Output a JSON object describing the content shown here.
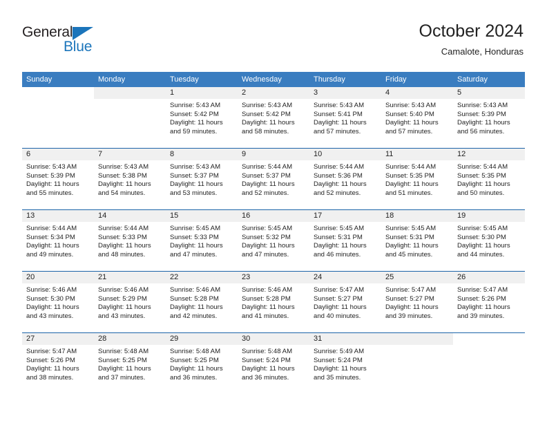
{
  "brand": {
    "name_top": "General",
    "name_bottom": "Blue",
    "accent_color": "#1b75bb"
  },
  "header": {
    "title": "October 2024",
    "subtitle": "Camalote, Honduras"
  },
  "colors": {
    "header_row": "#3a7dc0",
    "row_divider": "#1b63a8",
    "day_number_band": "#f0f0f0",
    "text": "#222222"
  },
  "weekday_headers": [
    "Sunday",
    "Monday",
    "Tuesday",
    "Wednesday",
    "Thursday",
    "Friday",
    "Saturday"
  ],
  "weeks": [
    [
      {
        "day": "",
        "sunrise": "",
        "sunset": "",
        "daylight": "",
        "empty": true,
        "shaded": false
      },
      {
        "day": "",
        "sunrise": "",
        "sunset": "",
        "daylight": "",
        "empty": true,
        "shaded": true
      },
      {
        "day": "1",
        "sunrise": "Sunrise: 5:43 AM",
        "sunset": "Sunset: 5:42 PM",
        "daylight": "Daylight: 11 hours and 59 minutes."
      },
      {
        "day": "2",
        "sunrise": "Sunrise: 5:43 AM",
        "sunset": "Sunset: 5:42 PM",
        "daylight": "Daylight: 11 hours and 58 minutes."
      },
      {
        "day": "3",
        "sunrise": "Sunrise: 5:43 AM",
        "sunset": "Sunset: 5:41 PM",
        "daylight": "Daylight: 11 hours and 57 minutes."
      },
      {
        "day": "4",
        "sunrise": "Sunrise: 5:43 AM",
        "sunset": "Sunset: 5:40 PM",
        "daylight": "Daylight: 11 hours and 57 minutes."
      },
      {
        "day": "5",
        "sunrise": "Sunrise: 5:43 AM",
        "sunset": "Sunset: 5:39 PM",
        "daylight": "Daylight: 11 hours and 56 minutes."
      }
    ],
    [
      {
        "day": "6",
        "sunrise": "Sunrise: 5:43 AM",
        "sunset": "Sunset: 5:39 PM",
        "daylight": "Daylight: 11 hours and 55 minutes."
      },
      {
        "day": "7",
        "sunrise": "Sunrise: 5:43 AM",
        "sunset": "Sunset: 5:38 PM",
        "daylight": "Daylight: 11 hours and 54 minutes."
      },
      {
        "day": "8",
        "sunrise": "Sunrise: 5:43 AM",
        "sunset": "Sunset: 5:37 PM",
        "daylight": "Daylight: 11 hours and 53 minutes."
      },
      {
        "day": "9",
        "sunrise": "Sunrise: 5:44 AM",
        "sunset": "Sunset: 5:37 PM",
        "daylight": "Daylight: 11 hours and 52 minutes."
      },
      {
        "day": "10",
        "sunrise": "Sunrise: 5:44 AM",
        "sunset": "Sunset: 5:36 PM",
        "daylight": "Daylight: 11 hours and 52 minutes."
      },
      {
        "day": "11",
        "sunrise": "Sunrise: 5:44 AM",
        "sunset": "Sunset: 5:35 PM",
        "daylight": "Daylight: 11 hours and 51 minutes."
      },
      {
        "day": "12",
        "sunrise": "Sunrise: 5:44 AM",
        "sunset": "Sunset: 5:35 PM",
        "daylight": "Daylight: 11 hours and 50 minutes."
      }
    ],
    [
      {
        "day": "13",
        "sunrise": "Sunrise: 5:44 AM",
        "sunset": "Sunset: 5:34 PM",
        "daylight": "Daylight: 11 hours and 49 minutes."
      },
      {
        "day": "14",
        "sunrise": "Sunrise: 5:44 AM",
        "sunset": "Sunset: 5:33 PM",
        "daylight": "Daylight: 11 hours and 48 minutes."
      },
      {
        "day": "15",
        "sunrise": "Sunrise: 5:45 AM",
        "sunset": "Sunset: 5:33 PM",
        "daylight": "Daylight: 11 hours and 47 minutes."
      },
      {
        "day": "16",
        "sunrise": "Sunrise: 5:45 AM",
        "sunset": "Sunset: 5:32 PM",
        "daylight": "Daylight: 11 hours and 47 minutes."
      },
      {
        "day": "17",
        "sunrise": "Sunrise: 5:45 AM",
        "sunset": "Sunset: 5:31 PM",
        "daylight": "Daylight: 11 hours and 46 minutes."
      },
      {
        "day": "18",
        "sunrise": "Sunrise: 5:45 AM",
        "sunset": "Sunset: 5:31 PM",
        "daylight": "Daylight: 11 hours and 45 minutes."
      },
      {
        "day": "19",
        "sunrise": "Sunrise: 5:45 AM",
        "sunset": "Sunset: 5:30 PM",
        "daylight": "Daylight: 11 hours and 44 minutes."
      }
    ],
    [
      {
        "day": "20",
        "sunrise": "Sunrise: 5:46 AM",
        "sunset": "Sunset: 5:30 PM",
        "daylight": "Daylight: 11 hours and 43 minutes."
      },
      {
        "day": "21",
        "sunrise": "Sunrise: 5:46 AM",
        "sunset": "Sunset: 5:29 PM",
        "daylight": "Daylight: 11 hours and 43 minutes."
      },
      {
        "day": "22",
        "sunrise": "Sunrise: 5:46 AM",
        "sunset": "Sunset: 5:28 PM",
        "daylight": "Daylight: 11 hours and 42 minutes."
      },
      {
        "day": "23",
        "sunrise": "Sunrise: 5:46 AM",
        "sunset": "Sunset: 5:28 PM",
        "daylight": "Daylight: 11 hours and 41 minutes."
      },
      {
        "day": "24",
        "sunrise": "Sunrise: 5:47 AM",
        "sunset": "Sunset: 5:27 PM",
        "daylight": "Daylight: 11 hours and 40 minutes."
      },
      {
        "day": "25",
        "sunrise": "Sunrise: 5:47 AM",
        "sunset": "Sunset: 5:27 PM",
        "daylight": "Daylight: 11 hours and 39 minutes."
      },
      {
        "day": "26",
        "sunrise": "Sunrise: 5:47 AM",
        "sunset": "Sunset: 5:26 PM",
        "daylight": "Daylight: 11 hours and 39 minutes."
      }
    ],
    [
      {
        "day": "27",
        "sunrise": "Sunrise: 5:47 AM",
        "sunset": "Sunset: 5:26 PM",
        "daylight": "Daylight: 11 hours and 38 minutes."
      },
      {
        "day": "28",
        "sunrise": "Sunrise: 5:48 AM",
        "sunset": "Sunset: 5:25 PM",
        "daylight": "Daylight: 11 hours and 37 minutes."
      },
      {
        "day": "29",
        "sunrise": "Sunrise: 5:48 AM",
        "sunset": "Sunset: 5:25 PM",
        "daylight": "Daylight: 11 hours and 36 minutes."
      },
      {
        "day": "30",
        "sunrise": "Sunrise: 5:48 AM",
        "sunset": "Sunset: 5:24 PM",
        "daylight": "Daylight: 11 hours and 36 minutes."
      },
      {
        "day": "31",
        "sunrise": "Sunrise: 5:49 AM",
        "sunset": "Sunset: 5:24 PM",
        "daylight": "Daylight: 11 hours and 35 minutes."
      },
      {
        "day": "",
        "sunrise": "",
        "sunset": "",
        "daylight": "",
        "empty": true,
        "shaded": true
      },
      {
        "day": "",
        "sunrise": "",
        "sunset": "",
        "daylight": "",
        "empty": true,
        "shaded": false
      }
    ]
  ]
}
